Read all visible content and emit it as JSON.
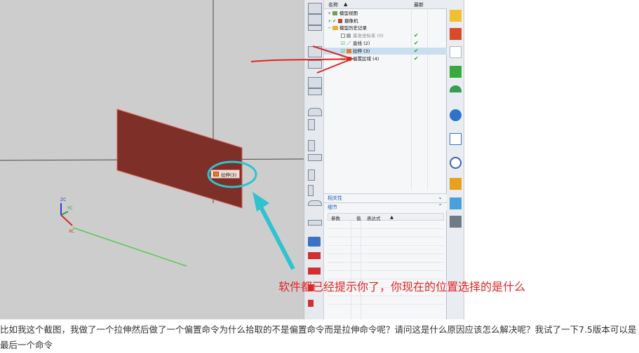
{
  "navigator": {
    "columns": {
      "name": "名称",
      "sort_arrow": "▲",
      "latest": "最新"
    },
    "tree": [
      {
        "label": "模型视图",
        "state": "",
        "dim": false,
        "selected": false
      },
      {
        "label": "摄像机",
        "state": "",
        "dim": false,
        "selected": false
      },
      {
        "label": "模型历史记录",
        "state": "",
        "dim": false,
        "selected": false
      },
      {
        "label": "基准坐标系 (0)",
        "state": "✔",
        "dim": true,
        "selected": false
      },
      {
        "label": "直线 (2)",
        "state": "✔",
        "dim": false,
        "selected": false
      },
      {
        "label": "拉伸 (3)",
        "state": "✔",
        "dim": false,
        "selected": true
      },
      {
        "label": "偏置区域 (4)",
        "state": "✔",
        "dim": false,
        "selected": false
      }
    ],
    "dependencies_label": "相关性",
    "details_label": "细节",
    "details_columns": {
      "param": "参数",
      "value": "值",
      "expression": "表达式",
      "sort_arrow": "▲"
    }
  },
  "viewport": {
    "tooltip_text": "拉伸(3)",
    "axes": {
      "zc": "ZC",
      "yc": "YC",
      "xc": "XC"
    },
    "face_color": "#7d2f28",
    "background": "#cdcdcd"
  },
  "annotation_text": "软件都已经提示你了，你现在的位置选择的是什么",
  "question_text": "比如我这个截图，我做了一个拉伸然后做了一个偏置命令为什么拾取的不是偏置命令而是拉伸命令呢？请问这是什么原因应该怎么解决呢？我试了一下7.5版本可以是最后一个命令",
  "colors": {
    "annotation": "#e02424",
    "highlight_ring": "#2fc3d0",
    "check": "#1ea62a"
  }
}
